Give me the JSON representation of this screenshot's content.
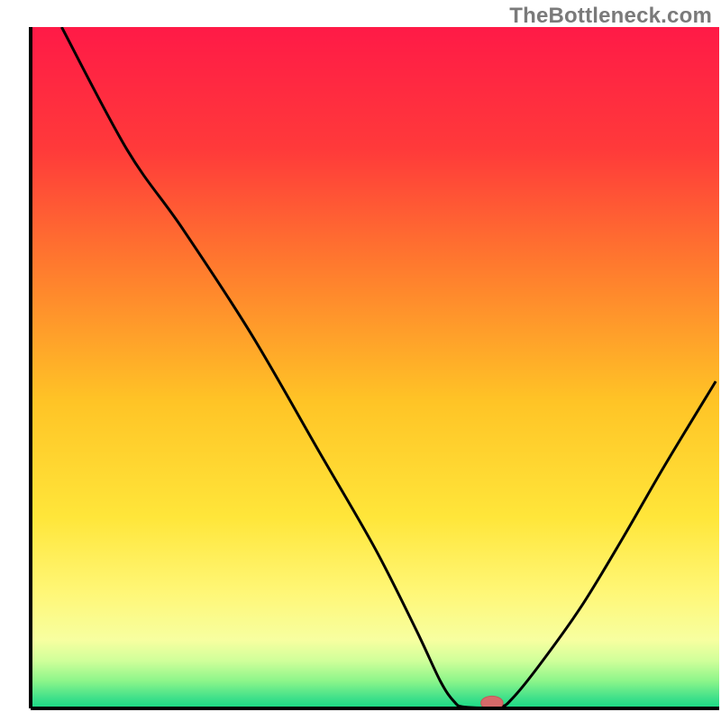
{
  "watermark": "TheBottleneck.com",
  "colors": {
    "axis": "#000000",
    "curve": "#000000",
    "marker_fill": "#d76a6a",
    "marker_stroke": "#c45a5a",
    "gradient_stops": [
      {
        "offset": 0.0,
        "color": "#ff1a47"
      },
      {
        "offset": 0.18,
        "color": "#ff3a3a"
      },
      {
        "offset": 0.35,
        "color": "#ff7a2e"
      },
      {
        "offset": 0.55,
        "color": "#ffc426"
      },
      {
        "offset": 0.72,
        "color": "#ffe63a"
      },
      {
        "offset": 0.83,
        "color": "#fff777"
      },
      {
        "offset": 0.9,
        "color": "#f7ffa0"
      },
      {
        "offset": 0.93,
        "color": "#d0ff9a"
      },
      {
        "offset": 0.96,
        "color": "#8cf58a"
      },
      {
        "offset": 0.985,
        "color": "#3fe08a"
      },
      {
        "offset": 1.0,
        "color": "#17d985"
      }
    ]
  },
  "chart_data": {
    "type": "line",
    "title": "",
    "xlabel": "",
    "ylabel": "",
    "xlim": [
      0,
      100
    ],
    "ylim": [
      0,
      100
    ],
    "curve": [
      {
        "x": 4.5,
        "y": 100.0
      },
      {
        "x": 14.0,
        "y": 82.0
      },
      {
        "x": 22.0,
        "y": 70.5
      },
      {
        "x": 32.0,
        "y": 55.0
      },
      {
        "x": 42.0,
        "y": 37.5
      },
      {
        "x": 50.0,
        "y": 23.5
      },
      {
        "x": 56.0,
        "y": 11.5
      },
      {
        "x": 59.5,
        "y": 4.0
      },
      {
        "x": 61.5,
        "y": 1.0
      },
      {
        "x": 63.0,
        "y": 0.2
      },
      {
        "x": 68.0,
        "y": 0.2
      },
      {
        "x": 70.0,
        "y": 1.5
      },
      {
        "x": 74.0,
        "y": 6.5
      },
      {
        "x": 80.0,
        "y": 15.0
      },
      {
        "x": 86.0,
        "y": 25.0
      },
      {
        "x": 92.0,
        "y": 35.5
      },
      {
        "x": 99.5,
        "y": 48.0
      }
    ],
    "marker": {
      "x": 67.0,
      "y": 0.8,
      "rx": 1.6,
      "ry": 1.0
    }
  }
}
